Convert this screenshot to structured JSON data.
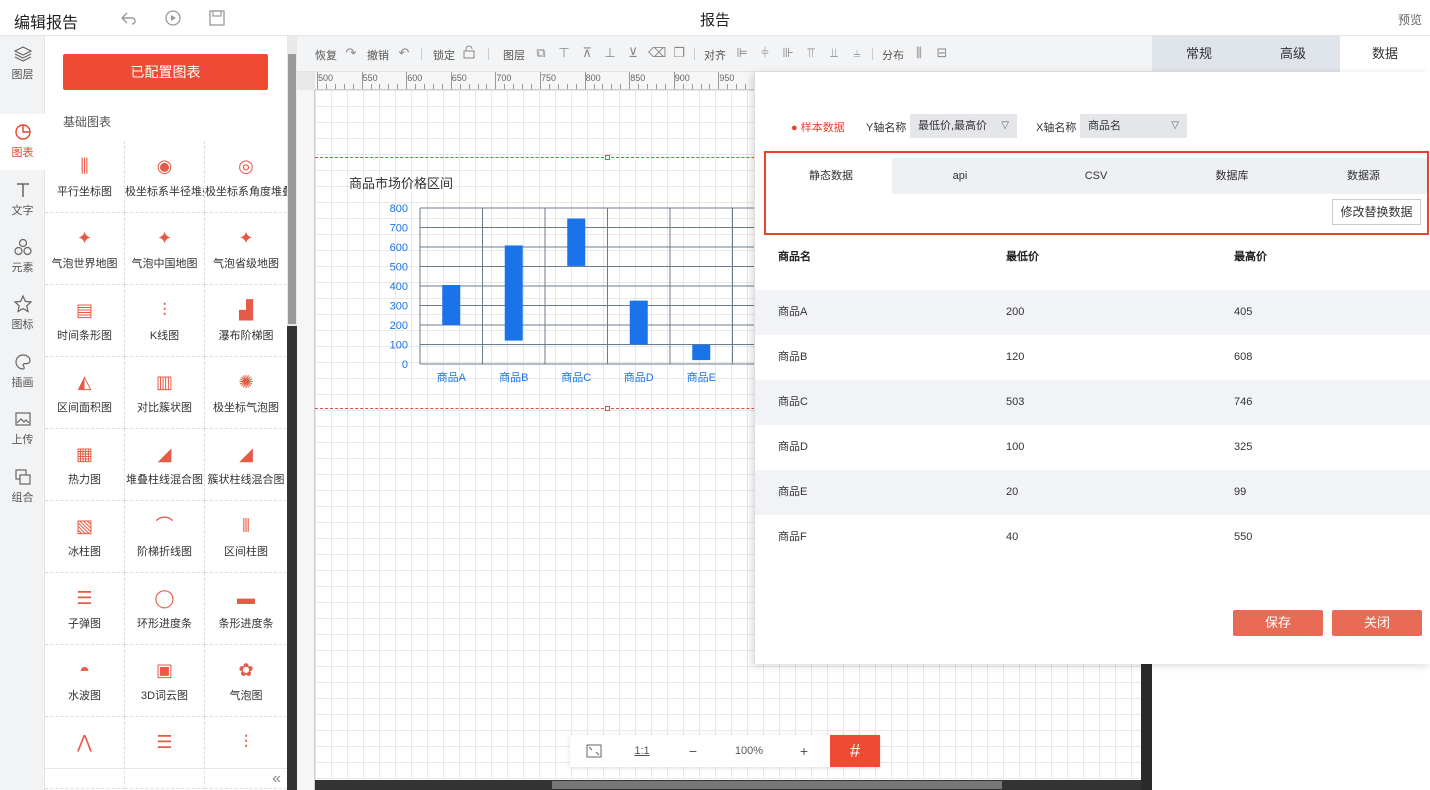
{
  "app": {
    "title": "编辑报告",
    "report_name": "报告",
    "preview": "预览"
  },
  "rail": [
    {
      "label": "图层",
      "icon": "layers-icon"
    },
    {
      "label": "图表",
      "icon": "chart-icon"
    },
    {
      "label": "文字",
      "icon": "text-icon"
    },
    {
      "label": "元素",
      "icon": "shapes-icon"
    },
    {
      "label": "图标",
      "icon": "star-icon"
    },
    {
      "label": "插画",
      "icon": "palette-icon"
    },
    {
      "label": "上传",
      "icon": "upload-image-icon"
    },
    {
      "label": "组合",
      "icon": "group-icon"
    }
  ],
  "library": {
    "configured_button": "已配置图表",
    "section_title": "基础图表",
    "items": [
      "平行坐标图",
      "极坐标系半径堆叠",
      "极坐标系角度堆叠",
      "气泡世界地图",
      "气泡中国地图",
      "气泡省级地图",
      "时间条形图",
      "K线图",
      "瀑布阶梯图",
      "区间面积图",
      "对比簇状图",
      "极坐标气泡图",
      "热力图",
      "堆叠柱线混合图",
      "簇状柱线混合图",
      "冰柱图",
      "阶梯折线图",
      "区间柱图",
      "子弹图",
      "环形进度条",
      "条形进度条",
      "水波图",
      "3D词云图",
      "气泡图",
      "",
      "",
      ""
    ]
  },
  "toolbar": {
    "redo": "恢复",
    "undo": "撤销",
    "lock": "锁定",
    "layer": "图层",
    "align": "对齐",
    "distribute": "分布"
  },
  "right_tabs": [
    "常规",
    "高级",
    "数据"
  ],
  "ruler": {
    "top": [
      "500",
      "550",
      "600",
      "650",
      "700",
      "750",
      "800",
      "850",
      "900",
      "950"
    ]
  },
  "chart_data": {
    "type": "bar",
    "title": "商品市场价格区间",
    "categories": [
      "商品A",
      "商品B",
      "商品C",
      "商品D",
      "商品E"
    ],
    "series": [
      {
        "name": "最低价",
        "values": [
          200,
          120,
          503,
          100,
          20
        ]
      },
      {
        "name": "最高价",
        "values": [
          405,
          608,
          746,
          325,
          99
        ]
      }
    ],
    "yticks": [
      "0",
      "100",
      "200",
      "300",
      "400",
      "500",
      "600",
      "700",
      "800"
    ],
    "ylim": [
      0,
      800
    ],
    "bar_color": "#1a73e8",
    "grid": true
  },
  "zoom": {
    "fit": "",
    "one_to_one": "1:1",
    "minus": "−",
    "level": "100%",
    "plus": "+"
  },
  "data_panel": {
    "sample_label": "● 样本数据",
    "y_label": "Y轴名称",
    "y_value": "最低价,最高价",
    "x_label": "X轴名称",
    "x_value": "商品名",
    "source_tabs": [
      "静态数据",
      "api",
      "CSV",
      "数据库",
      "数据源"
    ],
    "replace_button": "修改替换数据",
    "headers": [
      "商品名",
      "最低价",
      "最高价"
    ],
    "rows": [
      [
        "商品A",
        "200",
        "405"
      ],
      [
        "商品B",
        "120",
        "608"
      ],
      [
        "商品C",
        "503",
        "746"
      ],
      [
        "商品D",
        "100",
        "325"
      ],
      [
        "商品E",
        "20",
        "99"
      ],
      [
        "商品F",
        "40",
        "550"
      ]
    ],
    "save_button": "保存",
    "close_button": "关闭"
  },
  "colors": {
    "accent": "#f04a32",
    "bar": "#1a73e8",
    "highlight_border": "#e8432f"
  }
}
